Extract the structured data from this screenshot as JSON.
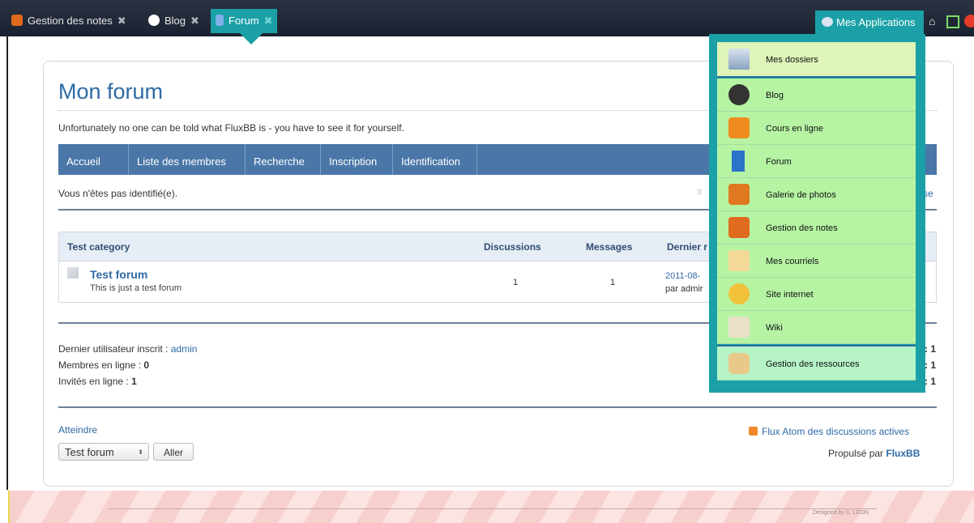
{
  "tabs": [
    {
      "label": "Gestion des notes",
      "icon": "gestion-notes-icon"
    },
    {
      "label": "Blog",
      "icon": "wordpress-icon"
    },
    {
      "label": "Forum",
      "icon": "forum-icon"
    }
  ],
  "apps_button": {
    "label": "Mes Applications"
  },
  "page": {
    "title": "Mon forum",
    "description": "Unfortunately no one can be told what FluxBB is - you have to see it for yourself.",
    "nav": [
      "Accueil",
      "Liste des membres",
      "Recherche",
      "Inscription",
      "Identification"
    ],
    "status": "Vous n'êtes pas identifié(e).",
    "status_right_partial": "se"
  },
  "table": {
    "headers": {
      "category": "Test category",
      "discussions": "Discussions",
      "messages": "Messages",
      "last": "Dernier r"
    },
    "row": {
      "name": "Test forum",
      "desc": "This is just a test forum",
      "discussions": "1",
      "messages": "1",
      "last_date": "2011-08-",
      "last_by": "par admir"
    }
  },
  "stats": {
    "last_user_label": "Dernier utilisateur inscrit : ",
    "last_user": "admin",
    "members_online_label": "Membres en ligne : ",
    "members_online": "0",
    "guests_online_label": "Invités en ligne : ",
    "guests_online": "1",
    "right_values": [
      ": 1",
      ": 1",
      ": 1"
    ]
  },
  "footer": {
    "atteindre": "Atteindre",
    "select_value": "Test forum",
    "go_button": "Aller",
    "feed": "Flux Atom des discussions actives",
    "powered_prefix": "Propulsé par ",
    "powered_brand": "FluxBB",
    "designed": "Designed by C. LEON"
  },
  "menu": [
    {
      "label": "Mes dossiers",
      "icon": "folder-icon"
    },
    {
      "label": "Blog",
      "icon": "wordpress-icon"
    },
    {
      "label": "Cours en ligne",
      "icon": "moodle-icon"
    },
    {
      "label": "Forum",
      "icon": "forum-icon"
    },
    {
      "label": "Galerie de photos",
      "icon": "camera-icon"
    },
    {
      "label": "Gestion des notes",
      "icon": "gestion-notes-icon"
    },
    {
      "label": "Mes courriels",
      "icon": "mail-icon"
    },
    {
      "label": "Site internet",
      "icon": "website-icon"
    },
    {
      "label": "Wiki",
      "icon": "wiki-icon"
    },
    {
      "label": "Gestion des ressources",
      "icon": "resources-icon"
    }
  ]
}
